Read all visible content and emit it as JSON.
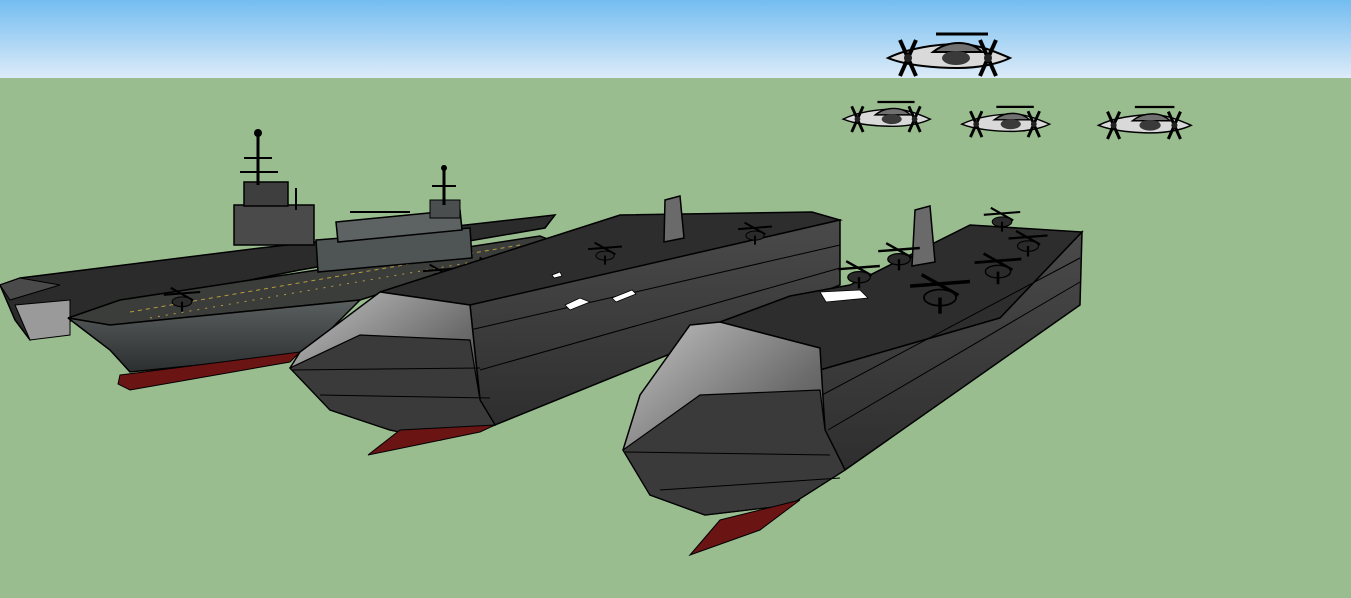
{
  "scene": {
    "type": "3d-model-viewport",
    "colors": {
      "sky_top": "#73bdf1",
      "sky_bottom": "#dcebf8",
      "ground": "#9abd8f",
      "hull_dark": "#3a3a3a",
      "hull_light": "#b5b5b5",
      "deck": "#2f2f2f",
      "waterline": "#6b1414",
      "outline": "#000000"
    },
    "objects": [
      {
        "kind": "aircraft-carrier",
        "label_name": "carrier-1"
      },
      {
        "kind": "amphibious-assault-ship",
        "label_name": "assault-ship"
      },
      {
        "kind": "catamaran-carrier",
        "label_name": "catamaran-1"
      },
      {
        "kind": "catamaran-carrier",
        "label_name": "catamaran-2"
      },
      {
        "kind": "tiltrotor",
        "count": 4
      }
    ]
  }
}
